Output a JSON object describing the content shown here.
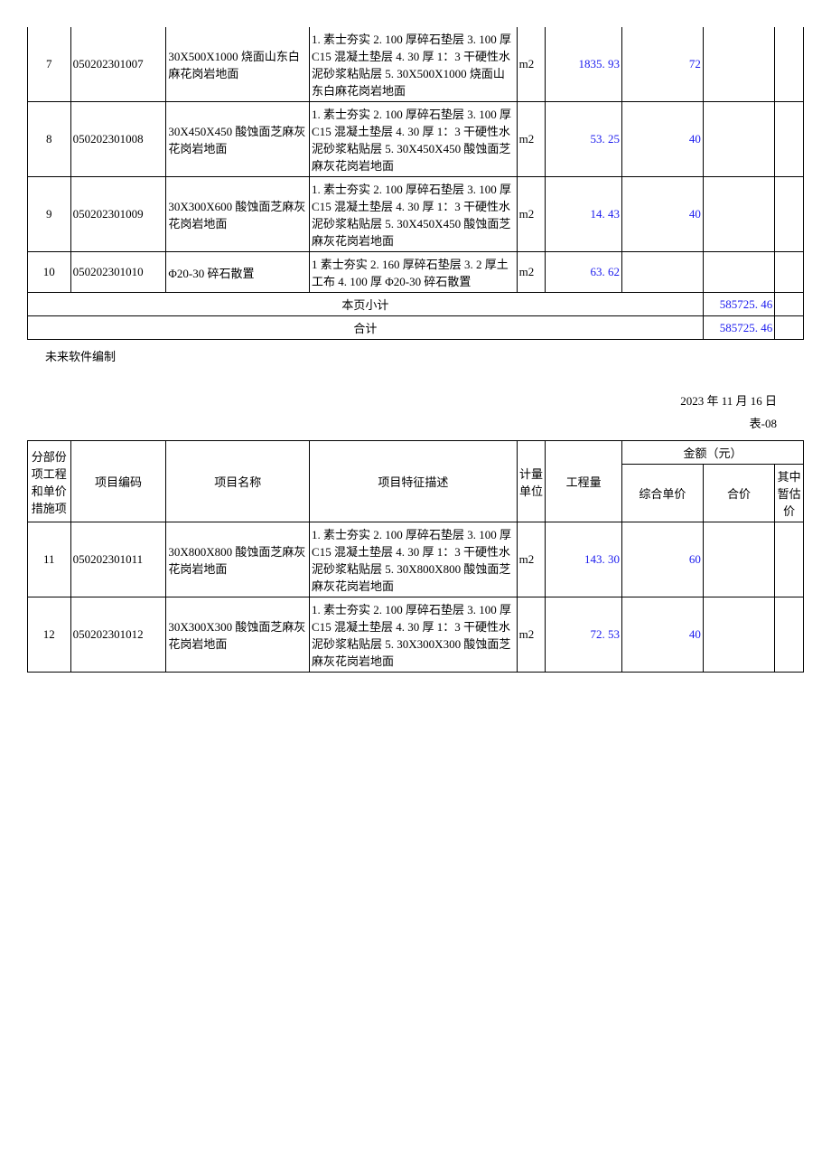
{
  "table1": {
    "rows": [
      {
        "seq": "7",
        "code": "050202301007",
        "name": "30X500X1000 烧面山东白麻花岗岩地面",
        "desc": "1. 素士夯实 2. 100 厚碎石垫层 3. 100 厚 C15 混凝土垫层 4. 30 厚 1：3 干硬性水泥砂浆粘贴层 5. 30X500X1000 烧面山东白麻花岗岩地面",
        "unit": "m2",
        "qty": "1835. 93",
        "price": "72",
        "total": "",
        "est": ""
      },
      {
        "seq": "8",
        "code": "050202301008",
        "name": "30X450X450 酸蚀面芝麻灰花岗岩地面",
        "desc": "1. 素士夯实 2. 100 厚碎石垫层 3. 100 厚 C15 混凝土垫层 4. 30 厚 1：3 干硬性水泥砂浆粘贴层 5. 30X450X450 酸蚀面芝麻灰花岗岩地面",
        "unit": "m2",
        "qty": "53. 25",
        "price": "40",
        "total": "",
        "est": ""
      },
      {
        "seq": "9",
        "code": "050202301009",
        "name": "30X300X600 酸蚀面芝麻灰花岗岩地面",
        "desc": "1. 素士夯实 2. 100 厚碎石垫层 3. 100 厚 C15 混凝土垫层 4. 30 厚 1：3 干硬性水泥砂浆粘贴层 5. 30X450X450 酸蚀面芝麻灰花岗岩地面",
        "unit": "m2",
        "qty": "14. 43",
        "price": "40",
        "total": "",
        "est": ""
      },
      {
        "seq": "10",
        "code": "050202301010",
        "name": "Φ20-30 碎石散置",
        "desc": "1 素士夯实 2. 160 厚碎石垫层 3. 2 厚土工布 4. 100 厚 Φ20-30 碎石散置",
        "unit": "m2",
        "qty": "63. 62",
        "price": "",
        "total": "",
        "est": ""
      }
    ],
    "subtotal_label": "本页小计",
    "subtotal_value": "585725. 46",
    "total_label": "合计",
    "total_value": "585725. 46"
  },
  "footer": {
    "note": "未来软件编制",
    "date": "2023 年 11 月 16 日",
    "table_num": "表-08"
  },
  "table2": {
    "headers": {
      "h1": "分部份项工程和单价措施项",
      "h2": "项目编码",
      "h3": "项目名称",
      "h4": "项目特征描述",
      "h5": "计量单位",
      "h6": "工程量",
      "h7": "金额（元）",
      "h7a": "综合单价",
      "h7b": "合价",
      "h7c": "其中暂估价"
    },
    "rows": [
      {
        "seq": "11",
        "code": "050202301011",
        "name": "30X800X800 酸蚀面芝麻灰花岗岩地面",
        "desc": "1. 素士夯实 2. 100 厚碎石垫层 3. 100 厚 C15 混凝土垫层 4. 30 厚 1：3 干硬性水泥砂浆粘贴层 5. 30X800X800 酸蚀面芝麻灰花岗岩地面",
        "unit": "m2",
        "qty": "143. 30",
        "price": "60",
        "total": "",
        "est": ""
      },
      {
        "seq": "12",
        "code": "050202301012",
        "name": "30X300X300 酸蚀面芝麻灰花岗岩地面",
        "desc": "1. 素士夯实 2. 100 厚碎石垫层 3. 100 厚 C15 混凝土垫层 4. 30 厚 1：3 干硬性水泥砂浆粘贴层 5. 30X300X300 酸蚀面芝麻灰花岗岩地面",
        "unit": "m2",
        "qty": "72. 53",
        "price": "40",
        "total": "",
        "est": ""
      }
    ]
  },
  "chart_data": {
    "type": "table",
    "title": "分部份项工程和单价措施项 / 金额（元）",
    "columns": [
      "项目编码",
      "项目名称",
      "项目特征描述",
      "计量单位",
      "工程量",
      "综合单价",
      "合价",
      "其中暂估价"
    ],
    "rows": [
      [
        "050202301007",
        "30X500X1000 烧面山东白麻花岗岩地面",
        "1. 素士夯实 2. 100 厚碎石垫层 3. 100 厚 C15 混凝土垫层 4. 30 厚 1：3 干硬性水泥砂浆粘贴层 5. 30X500X1000 烧面山东白麻花岗岩地面",
        "m2",
        1835.93,
        72,
        null,
        null
      ],
      [
        "050202301008",
        "30X450X450 酸蚀面芝麻灰花岗岩地面",
        "1. 素士夯实 2. 100 厚碎石垫层 3. 100 厚 C15 混凝土垫层 4. 30 厚 1：3 干硬性水泥砂浆粘贴层 5. 30X450X450 酸蚀面芝麻灰花岗岩地面",
        "m2",
        53.25,
        40,
        null,
        null
      ],
      [
        "050202301009",
        "30X300X600 酸蚀面芝麻灰花岗岩地面",
        "1. 素士夯实 2. 100 厚碎石垫层 3. 100 厚 C15 混凝土垫层 4. 30 厚 1：3 干硬性水泥砂浆粘贴层 5. 30X450X450 酸蚀面芝麻灰花岗岩地面",
        "m2",
        14.43,
        40,
        null,
        null
      ],
      [
        "050202301010",
        "Φ20-30 碎石散置",
        "1 素士夯实 2. 160 厚碎石垫层 3. 2 厚土工布 4. 100 厚 Φ20-30 碎石散置",
        "m2",
        63.62,
        null,
        null,
        null
      ],
      [
        "050202301011",
        "30X800X800 酸蚀面芝麻灰花岗岩地面",
        "1. 素士夯实 2. 100 厚碎石垫层 3. 100 厚 C15 混凝土垫层 4. 30 厚 1：3 干硬性水泥砂浆粘贴层 5. 30X800X800 酸蚀面芝麻灰花岗岩地面",
        "m2",
        143.3,
        60,
        null,
        null
      ],
      [
        "050202301012",
        "30X300X300 酸蚀面芝麻灰花岗岩地面",
        "1. 素士夯实 2. 100 厚碎石垫层 3. 100 厚 C15 混凝土垫层 4. 30 厚 1：3 干硬性水泥砂浆粘贴层 5. 30X300X300 酸蚀面芝麻灰花岗岩地面",
        "m2",
        72.53,
        40,
        null,
        null
      ]
    ],
    "page_subtotal": 585725.46,
    "grand_total": 585725.46
  }
}
